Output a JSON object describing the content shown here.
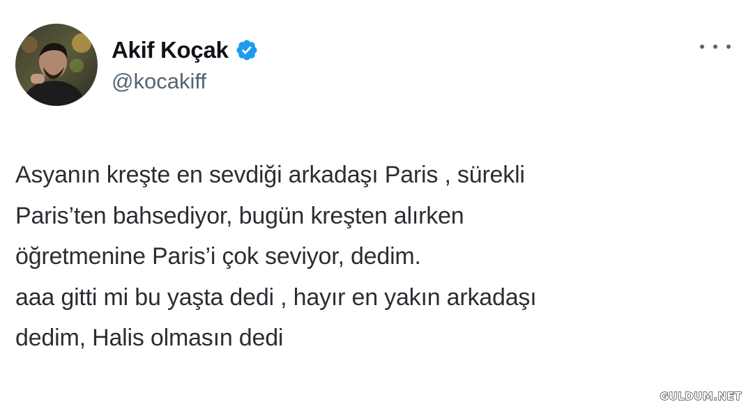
{
  "tweet": {
    "display_name": "Akif Koçak",
    "handle": "@kocakiff",
    "verified": true,
    "verified_color": "#1d9bf0",
    "body_lines": [
      "Asyanın kreşte en sevdiği arkadaşı Paris , sürekli",
      "Paris’ten bahsediyor, bugün kreşten alırken",
      "öğretmenine Paris’i çok seviyor, dedim.",
      "aaa gitti mi bu yaşta dedi , hayır en yakın arkadaşı",
      "dedim, Halis olmasın dedi"
    ]
  },
  "icons": {
    "avatar": "profile-photo",
    "verified": "verified-badge-icon",
    "more": "more-options-icon"
  },
  "watermark": {
    "text": "GULDUM.NET"
  }
}
